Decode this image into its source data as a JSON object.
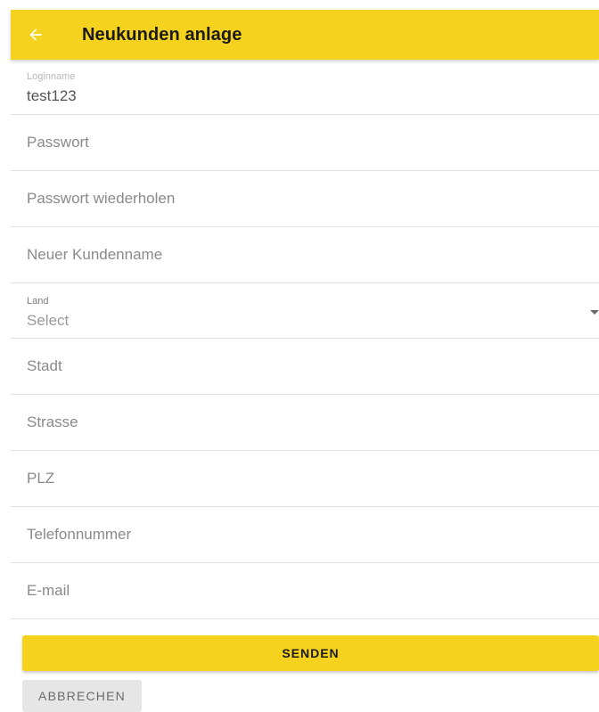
{
  "toolbar": {
    "title": "Neukunden anlage",
    "back_icon": "arrow-left-icon"
  },
  "form": {
    "loginname": {
      "label": "Loginname",
      "value": "test123"
    },
    "passwort": {
      "placeholder": "Passwort"
    },
    "passwort_wiederholen": {
      "placeholder": "Passwort wiederholen"
    },
    "kundenname": {
      "placeholder": "Neuer Kundenname"
    },
    "land": {
      "label": "Land",
      "value": "Select"
    },
    "stadt": {
      "placeholder": "Stadt"
    },
    "strasse": {
      "placeholder": "Strasse"
    },
    "plz": {
      "placeholder": "PLZ"
    },
    "telefon": {
      "placeholder": "Telefonnummer"
    },
    "email": {
      "placeholder": "E-mail"
    }
  },
  "actions": {
    "send_label": "SENDEN",
    "cancel_label": "ABBRECHEN"
  },
  "colors": {
    "accent": "#f5d21d",
    "cancel_bg": "#e6e6e6"
  }
}
